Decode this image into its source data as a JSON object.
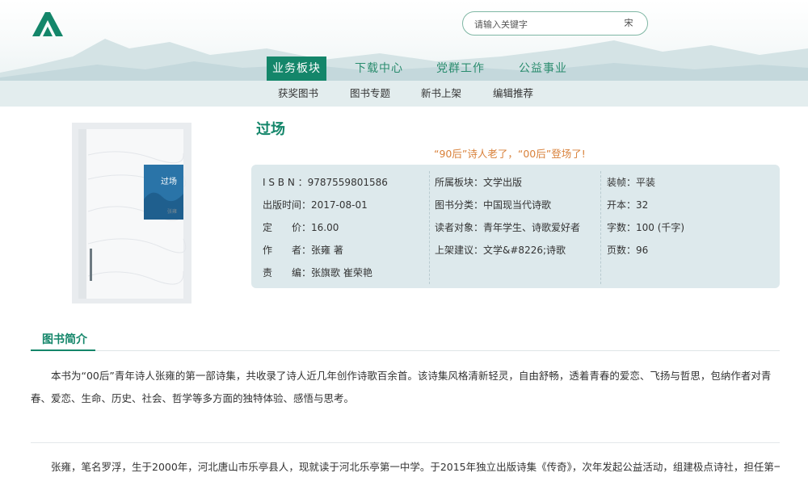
{
  "header": {
    "search_placeholder": "请输入关键字",
    "search_button": "宋"
  },
  "main_nav": [
    {
      "label": "业务板块",
      "active": true
    },
    {
      "label": "下载中心",
      "active": false
    },
    {
      "label": "党群工作",
      "active": false
    },
    {
      "label": "公益事业",
      "active": false
    }
  ],
  "sub_nav": [
    "获奖图书",
    "图书专题",
    "新书上架",
    "编辑推荐"
  ],
  "book": {
    "title": "过场",
    "slogan": "“90后”诗人老了，“00后”登场了!",
    "cover_title": "过场",
    "cover_author": "张雍",
    "info_left": [
      {
        "label": "I S B N ：",
        "value": "9787559801586"
      },
      {
        "label": "出版时间：",
        "value": "2017-08-01"
      },
      {
        "label": "定　　价：",
        "value": "16.00"
      },
      {
        "label": "作　　者：",
        "value": "张雍 著"
      },
      {
        "label": "责　　编：",
        "value": "张旗歌 崔荣艳"
      }
    ],
    "info_mid": [
      {
        "label": "所属板块：",
        "value": "文学出版"
      },
      {
        "label": "图书分类：",
        "value": "中国现当代诗歌"
      },
      {
        "label": "读者对象：",
        "value": "青年学生、诗歌爱好者"
      },
      {
        "label": "上架建议：",
        "value": "文学&#8226;诗歌"
      }
    ],
    "info_right": [
      {
        "label": "装帧：",
        "value": "平装"
      },
      {
        "label": "开本：",
        "value": "32"
      },
      {
        "label": "字数：",
        "value": "100 (千字)"
      },
      {
        "label": "页数：",
        "value": "96"
      }
    ]
  },
  "intro": {
    "heading": "图书简介",
    "paragraph1": "本书为“00后”青年诗人张雍的第一部诗集，共收录了诗人近几年创作诗歌百余首。该诗集风格清新轻灵，自由舒畅，透着青春的爱恋、飞扬与哲思，包纳作者对青春、爱恋、生命、历史、社会、哲学等多方面的独特体验、感悟与思考。",
    "paragraph2": "张雍，笔名罗浮，生于2000年，河北唐山市乐亭县人，现就读于河北乐亭第一中学。于2015年独立出版诗集《传奇》，次年发起公益活动，组建极点诗社，担任第一"
  },
  "colors": {
    "brand_green": "#14866a",
    "slogan_orange": "#d9813a",
    "panel_bg": "#dde9ec"
  }
}
